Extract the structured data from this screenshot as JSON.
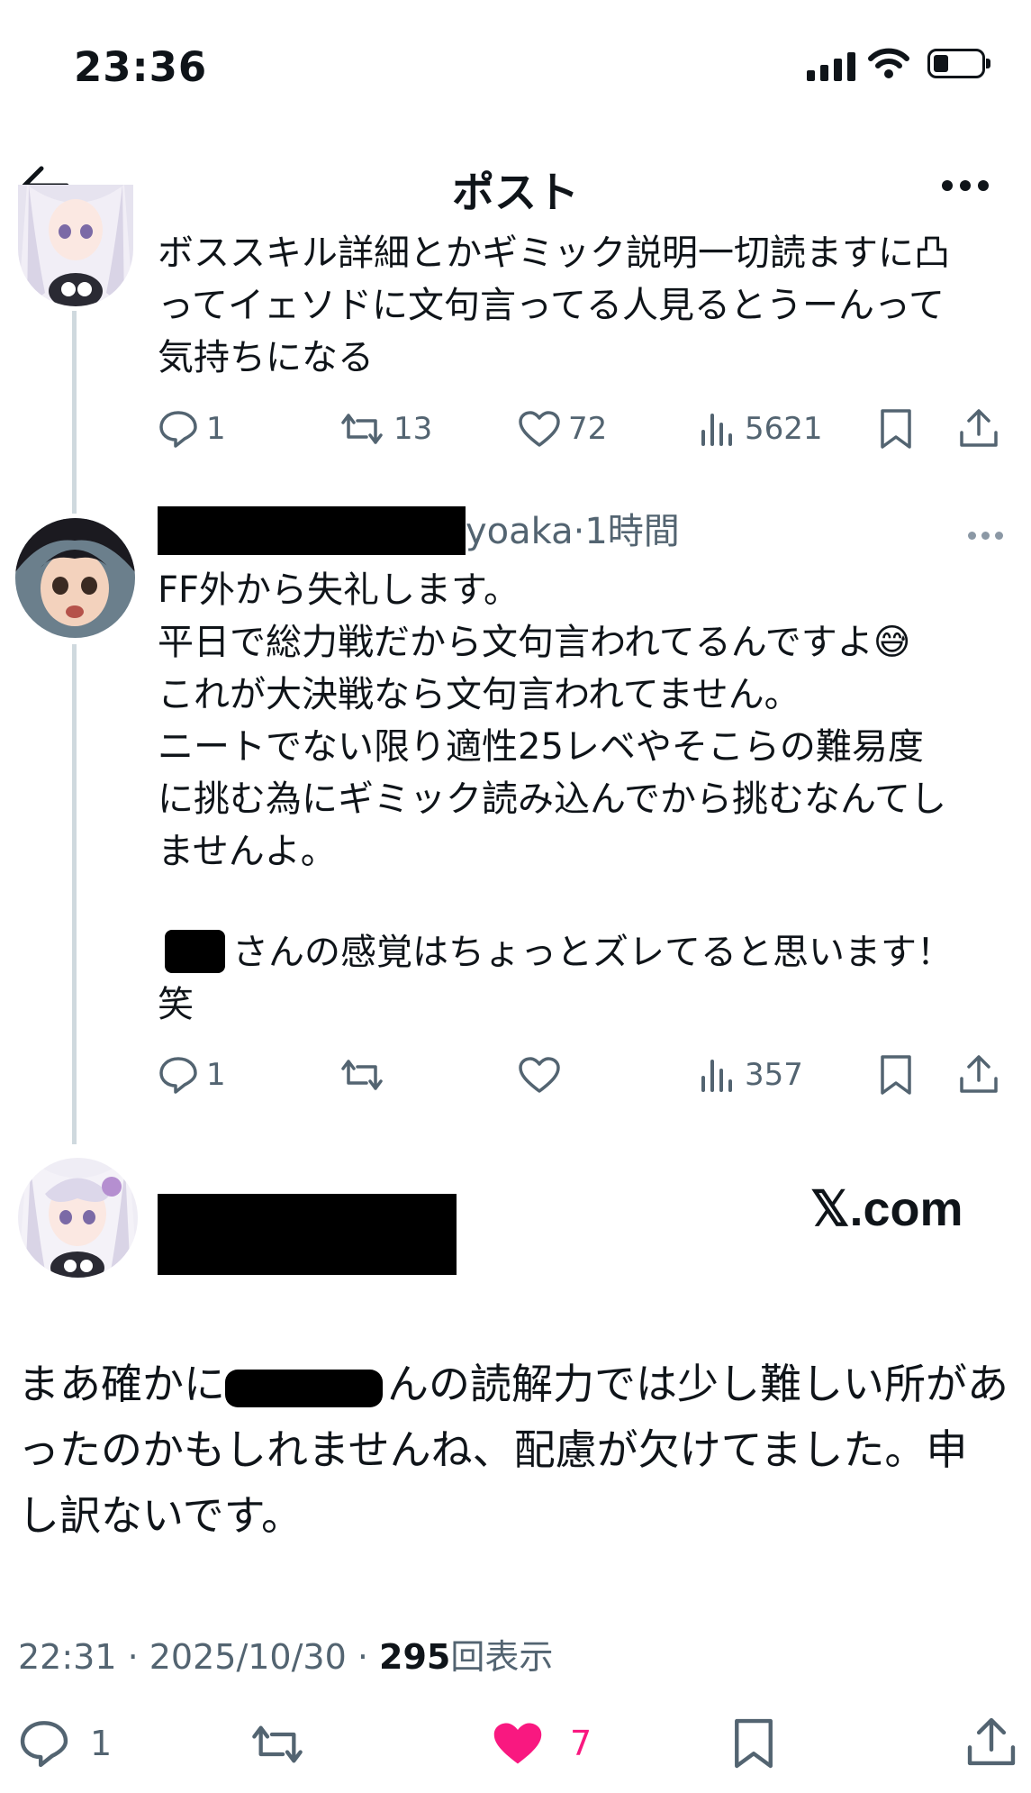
{
  "status_bar": {
    "time": "23:36"
  },
  "header": {
    "title": "ポスト"
  },
  "tweet1": {
    "text": "ボススキル詳細とかギミック説明一切読ますに凸\nってイェソドに文句言ってる人見るとうーんって\n気持ちになる",
    "actions": {
      "replies": "1",
      "reposts": "13",
      "likes": "72",
      "views": "5621"
    }
  },
  "tweet2": {
    "handle_visible": "yoaka",
    "time": "·1時間",
    "text": "FF外から失礼します。\n平日で総力戦だから文句言われてるんですよ😅\nこれが大決戦なら文句言われてません。\nニートでない限り適性25レベやそこらの難易度\nに挑む為にギミック読み込んでから挑むなんてし\nませんよ。",
    "text2_suffix": "さんの感覚はちょっとズレてると思います！",
    "text2_end": "笑",
    "actions": {
      "replies": "1",
      "views": "357"
    }
  },
  "main": {
    "watermark": "𝕏.com",
    "text_1": "まあ確かに",
    "text_2": "んの読解力では少し難しい所があ\nったのかもしれませんね、配慮が欠けてました。申\nし訳ないです。",
    "meta_time": "22:31 · 2025/10/30 · ",
    "meta_views": "295",
    "meta_views_label": "回表示",
    "actions": {
      "replies": "1",
      "likes": "7"
    }
  },
  "colors": {
    "text": "#0f1419",
    "gray": "#536471",
    "like": "#f91880",
    "thread": "#cfd9de"
  }
}
